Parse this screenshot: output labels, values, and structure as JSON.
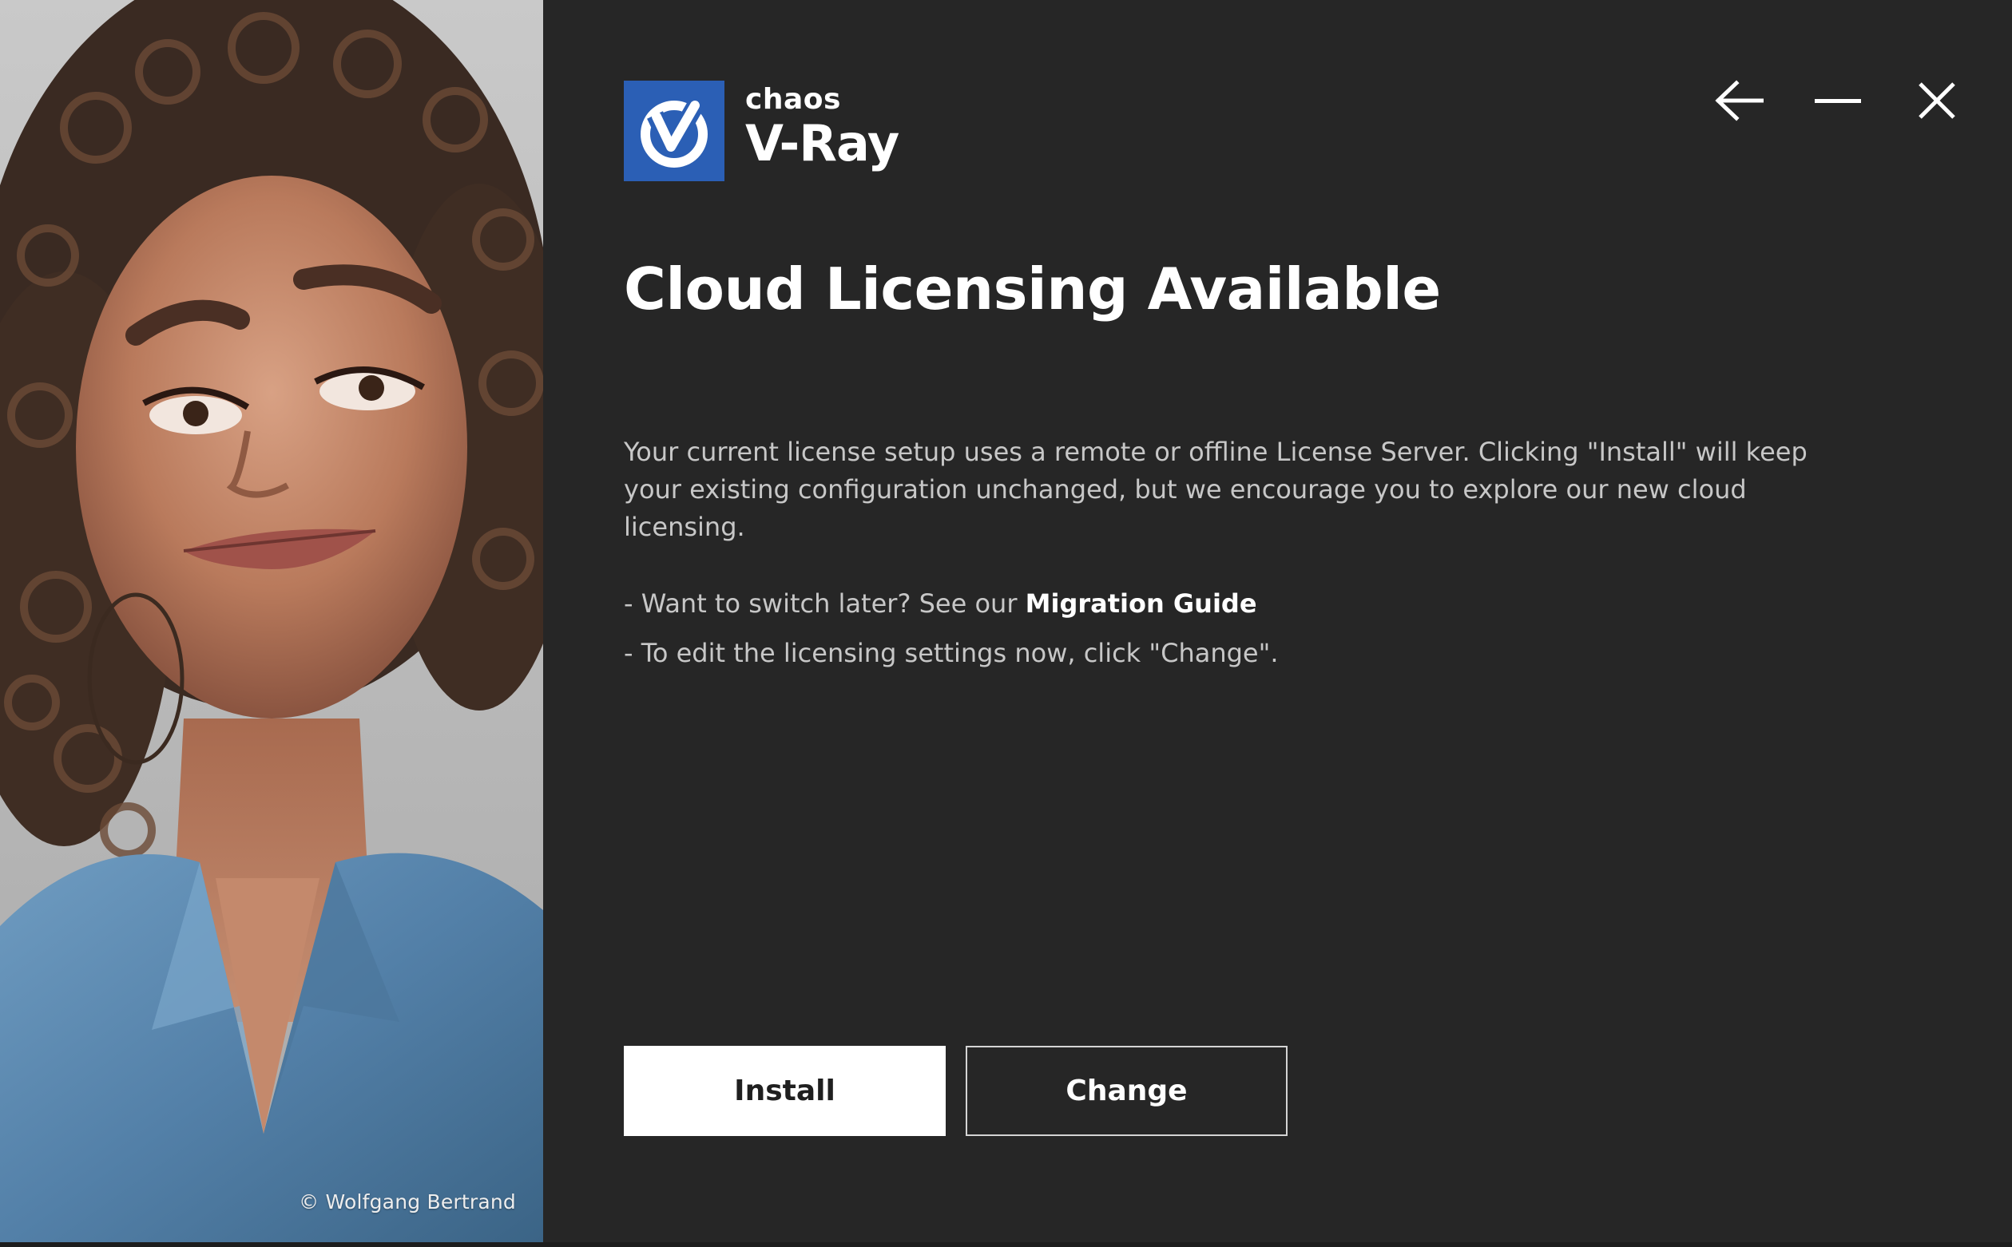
{
  "art": {
    "credit": "© Wolfgang Bertrand"
  },
  "brand": {
    "company": "chaos",
    "product": "V-Ray",
    "logo_icon": "vray-v-logo-icon",
    "logo_color": "#2b5fb5"
  },
  "window_controls": {
    "back_icon": "arrow-left-icon",
    "minimize_icon": "minimize-icon",
    "close_icon": "close-icon"
  },
  "main": {
    "title": "Cloud Licensing Available",
    "description": "Your current license setup uses a remote or offline License Server. Clicking \"Install\" will keep your existing configuration unchanged, but we encourage you to explore our new cloud licensing.",
    "bullets": [
      {
        "prefix": "- Want to switch later? See our ",
        "link": "Migration Guide"
      },
      {
        "text": "- To edit the licensing settings now, click \"Change\"."
      }
    ]
  },
  "actions": {
    "install_label": "Install",
    "change_label": "Change"
  },
  "colors": {
    "background": "#262626",
    "text_primary": "#ffffff",
    "text_secondary": "#c7c7c7",
    "accent": "#2b5fb5"
  }
}
